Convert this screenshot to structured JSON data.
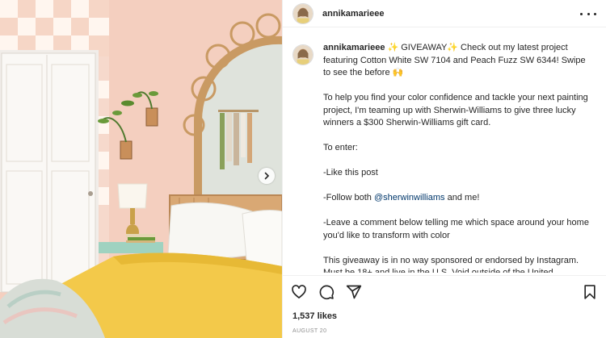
{
  "post": {
    "username": "annikamarieee",
    "caption": {
      "username": "annikamarieee",
      "intro": "✨ GIVEAWAY✨ Check out my latest project featuring Cotton White SW 7104 and Peach Fuzz SW 6344! Swipe to see the before 🙌",
      "para2": "To help you find your color confidence and tackle your next painting project, I'm teaming up with Sherwin-Williams to give three lucky winners a $300 Sherwin-Williams gift card.",
      "para3": "To enter:",
      "para4": "-Like this post",
      "para5_prefix": "-Follow both",
      "para5_mention": "@sherwinwilliams",
      "para5_suffix": "and me!",
      "para6": "-Leave a comment below telling me which space around your home you'd like to transform with color",
      "para7": "This giveaway is in no way sponsored or endorsed by Instagram. Must be 18+ and live in the U.S. Void outside of the United"
    },
    "likes": "1,537 likes",
    "date": "AUGUST 20"
  },
  "icons": {
    "like": "heart-icon",
    "comment": "comment-icon",
    "share": "share-icon",
    "save": "bookmark-icon",
    "more": "more-options-icon",
    "next": "chevron-right-icon"
  },
  "colors": {
    "text": "#262626",
    "secondary": "#8e8e8e",
    "mention": "#00376b",
    "wall": "#f3cdbd",
    "bedspread": "#f2c744"
  }
}
